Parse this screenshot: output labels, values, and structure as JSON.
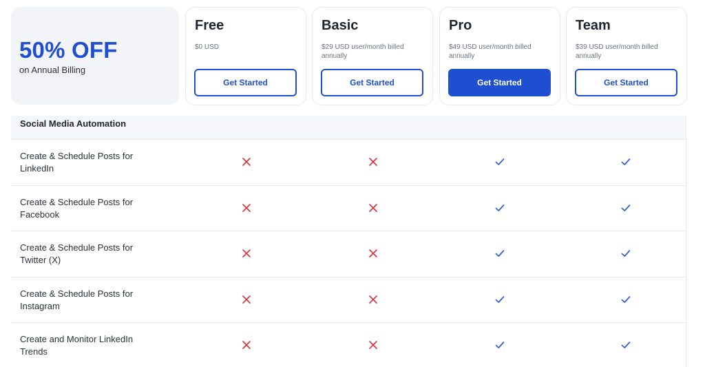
{
  "promo": {
    "headline": "50% OFF",
    "subtext": "on Annual Billing"
  },
  "plans": [
    {
      "name": "Free",
      "price": "$0 USD",
      "button": "Get Started",
      "highlighted": false
    },
    {
      "name": "Basic",
      "price": "$29 USD user/month billed annually",
      "button": "Get Started",
      "highlighted": false
    },
    {
      "name": "Pro",
      "price": "$49 USD user/month billed annually",
      "button": "Get Started",
      "highlighted": true
    },
    {
      "name": "Team",
      "price": "$39 USD user/month billed annually",
      "button": "Get Started",
      "highlighted": false
    }
  ],
  "section": {
    "title": "Social Media Automation"
  },
  "features": [
    {
      "label": "Create & Schedule Posts for LinkedIn",
      "availability": [
        "cross",
        "cross",
        "check",
        "check"
      ]
    },
    {
      "label": "Create & Schedule Posts for Facebook",
      "availability": [
        "cross",
        "cross",
        "check",
        "check"
      ]
    },
    {
      "label": "Create & Schedule Posts for Twitter (X)",
      "availability": [
        "cross",
        "cross",
        "check",
        "check"
      ]
    },
    {
      "label": "Create & Schedule Posts for Instagram",
      "availability": [
        "cross",
        "cross",
        "check",
        "check"
      ]
    },
    {
      "label": "Create and Monitor LinkedIn Trends",
      "availability": [
        "cross",
        "cross",
        "check",
        "check"
      ]
    }
  ],
  "colors": {
    "brand": "#1f4fd1",
    "cross": "#d9363e",
    "check": "#2f5bd6"
  },
  "icons": {
    "cross": "cross-icon",
    "check": "check-icon"
  }
}
